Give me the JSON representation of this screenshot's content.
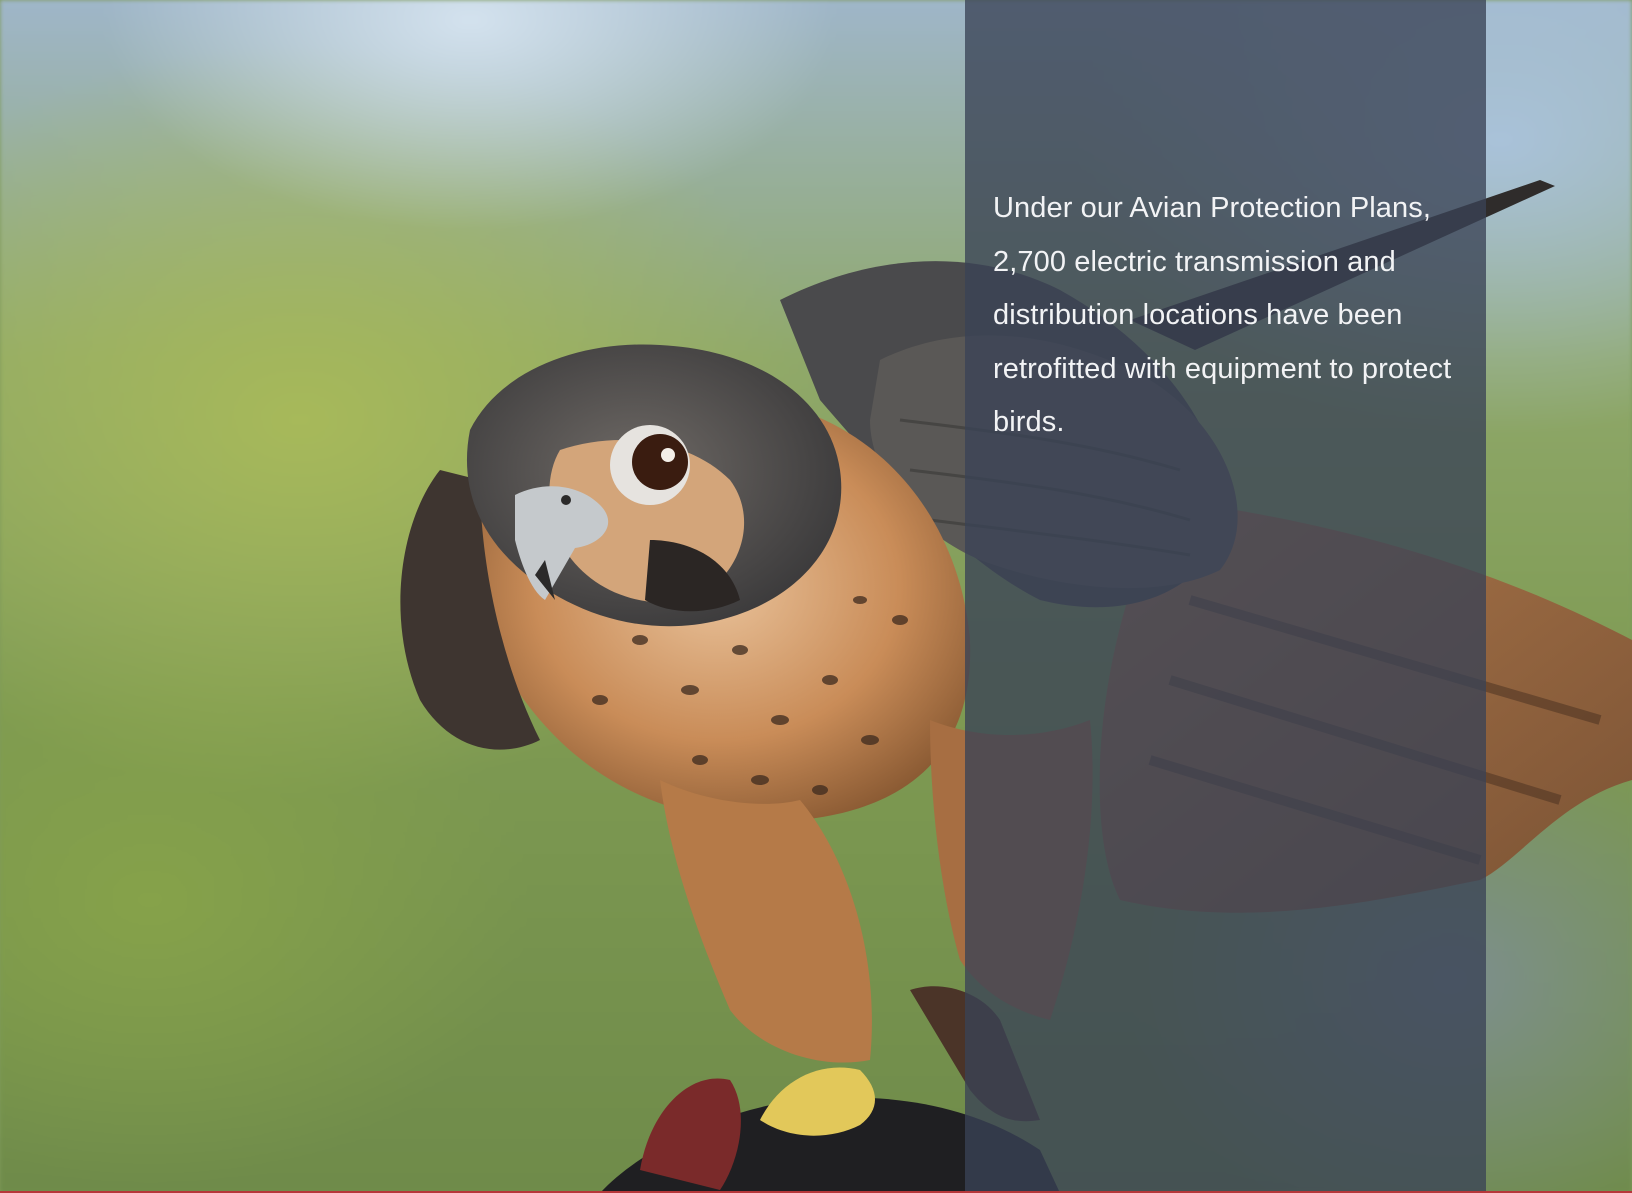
{
  "caption": {
    "text": "Under our Avian Protection Plans, 2,700 electric transmission and distribution locations have been retrofitted with equipment to protect birds."
  },
  "colors": {
    "panel": "#3a4256",
    "caption_text": "#f2f3f5",
    "bottom_rule": "#b7373a"
  },
  "image": {
    "subject": "falcon-perched-on-glove-photo"
  }
}
